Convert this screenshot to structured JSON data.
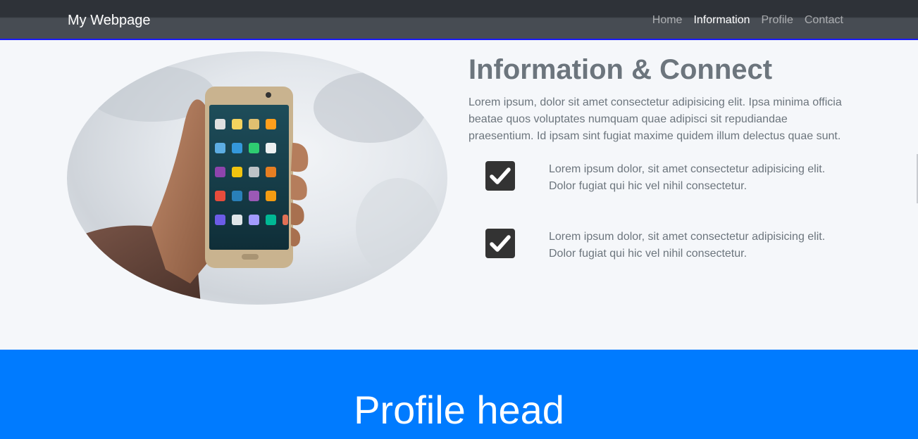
{
  "navbar": {
    "brand": "My Webpage",
    "links": [
      {
        "label": "Home",
        "active": false
      },
      {
        "label": "Information",
        "active": true
      },
      {
        "label": "Profile",
        "active": false
      },
      {
        "label": "Contact",
        "active": false
      }
    ]
  },
  "information": {
    "title": "Information & Connect",
    "text": "Lorem ipsum, dolor sit amet consectetur adipisicing elit. Ipsa minima officia beatae quos voluptates numquam quae adipisci sit repudiandae praesentium. Id ipsam sint fugiat maxime quidem illum delectus quae sunt.",
    "features": [
      {
        "icon": "check-square-icon",
        "text": "Lorem ipsum dolor, sit amet consectetur adipisicing elit. Dolor fugiat qui hic vel nihil consectetur."
      },
      {
        "icon": "check-square-icon",
        "text": "Lorem ipsum dolor, sit amet consectetur adipisicing elit. Dolor fugiat qui hic vel nihil consectetur."
      }
    ]
  },
  "profile": {
    "heading": "Profile head"
  },
  "colors": {
    "navbar": "#474c53",
    "navbar_border": "#1a1aff",
    "profile_bg": "#007bff",
    "text_muted": "#6c757d",
    "check_bg": "#333333"
  }
}
